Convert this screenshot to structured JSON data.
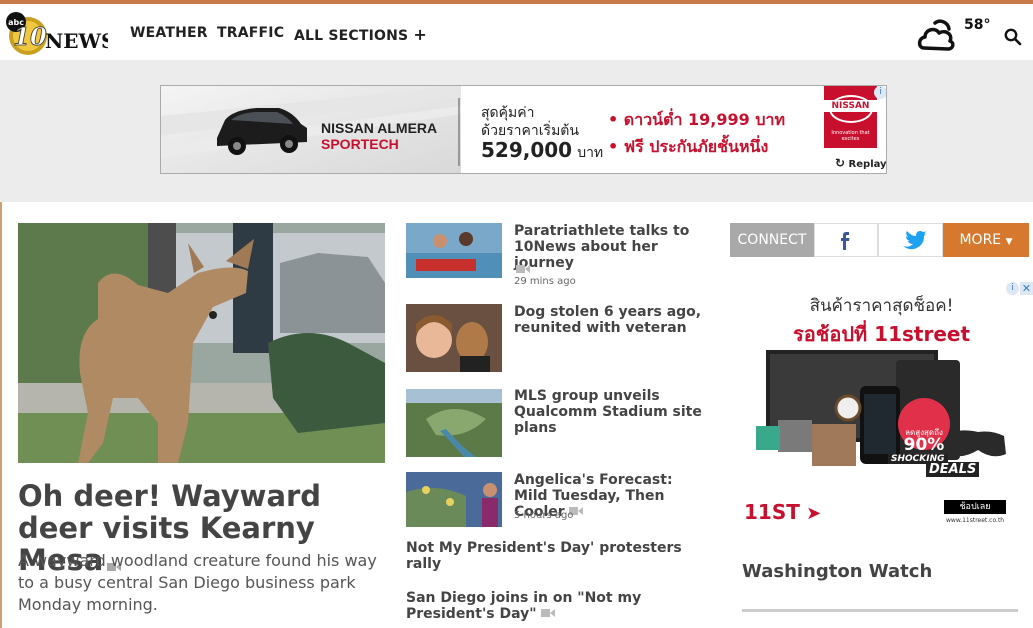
{
  "header": {
    "logo_small": "abc",
    "logo_number": "10",
    "logo_text": "NEWS",
    "nav": [
      "WEATHER",
      "TRAFFIC",
      "ALL SECTIONS"
    ],
    "temperature": "58°"
  },
  "top_ad": {
    "car_name_1": "NISSAN ALMERA",
    "car_name_2": "SPORTECH",
    "price_line_1": "สุดคุ้มค่า",
    "price_line_2": "ด้วยราคาเริ่มต้น",
    "price_value": "529,000",
    "price_unit": "บาท",
    "offer_1": "• ดาวน์ต่ำ 19,999 บาท",
    "offer_2": "• ฟรี ประกันภัยชั้นหนึ่ง",
    "brand": "NISSAN",
    "brand_tag": "Innovation that excites",
    "replay": "Replay"
  },
  "featured": {
    "headline": "Oh deer! Wayward deer visits Kearny Mesa",
    "summary": "A wayward woodland creature found his way to a busy central San Diego business park Monday morning."
  },
  "stories": [
    {
      "title": "Paratriathlete talks to 10News about her journey",
      "time": "29 mins ago"
    },
    {
      "title": "Dog stolen 6 years ago, reunited with veteran",
      "time": ""
    },
    {
      "title": "MLS group unveils Qualcomm Stadium site plans",
      "time": ""
    },
    {
      "title": "Angelica's Forecast: Mild Tuesday, Then Cooler",
      "time": "5 hours ago"
    }
  ],
  "plain_stories": [
    {
      "title": "Not My President's Day' protesters rally"
    },
    {
      "title": "San Diego joins in on \"Not my President's Day\""
    }
  ],
  "connect": {
    "label": "CONNECT",
    "more": "MORE"
  },
  "side_ad": {
    "line_1": "สินค้าราคาสุดช็อค!",
    "line_2": "รอช้อปที่ 11street",
    "badge_small": "ลดสูงสุดถึง",
    "badge_pct": "90%",
    "shocking": "SHOCKING",
    "deals": "DEALS",
    "brand": "11ST",
    "cta": "ช้อปเลย",
    "url": "www.11street.co.th"
  },
  "sidebar": {
    "section_title": "Washington Watch"
  },
  "colors": {
    "accent_orange": "#d6792f",
    "facebook": "#3b5998",
    "twitter": "#1da1f2",
    "ad_red": "#c8102e"
  }
}
